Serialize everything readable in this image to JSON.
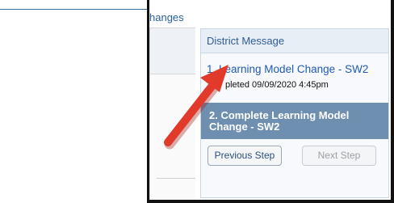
{
  "header": {
    "link_text": "hanges"
  },
  "district": {
    "title": "District Message",
    "step1_label": "1. Learning Model Change - SW2",
    "step1_status": "pleted 09/09/2020 4:45pm",
    "step2_line1": "2. Complete Learning Model",
    "step2_line2": "Change - SW2"
  },
  "buttons": {
    "previous": "Previous Step",
    "next": "Next Step"
  },
  "annotation": {
    "arrow_color": "#e23a2a"
  }
}
